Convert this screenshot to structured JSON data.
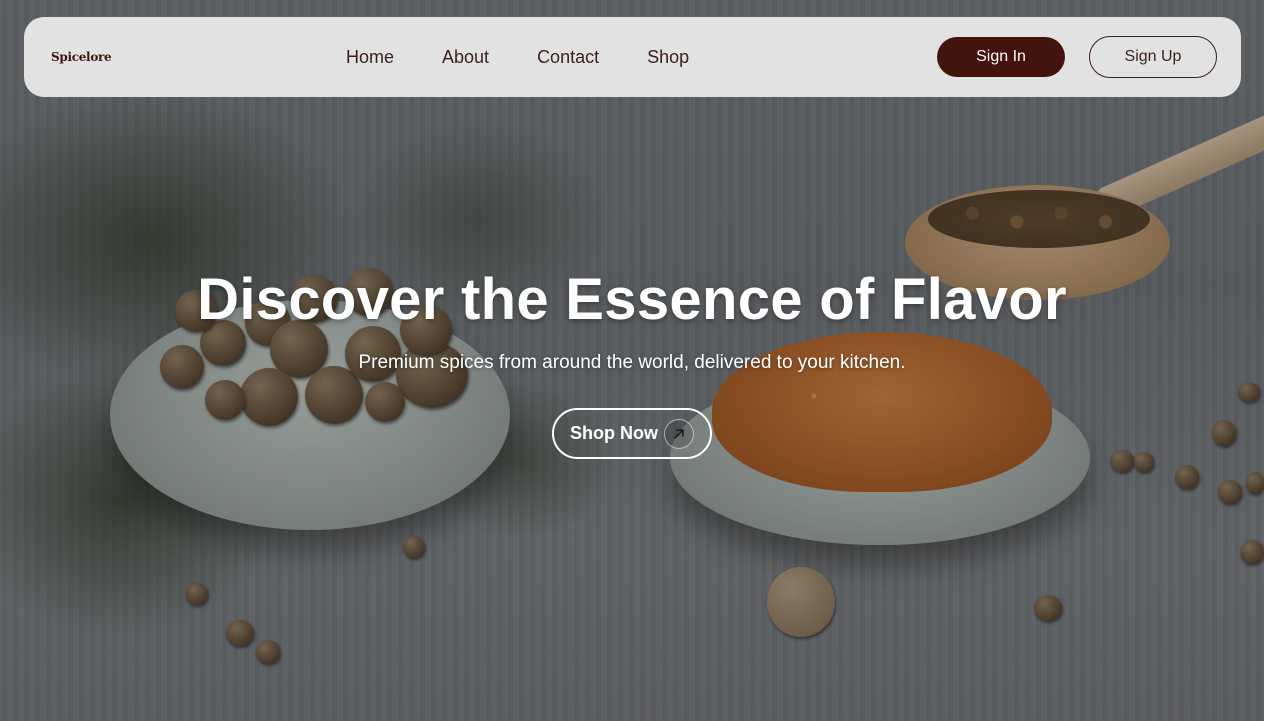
{
  "brand": {
    "logo_text": "Spicelore"
  },
  "nav": {
    "links": [
      {
        "label": "Home"
      },
      {
        "label": "About"
      },
      {
        "label": "Contact"
      },
      {
        "label": "Shop"
      }
    ],
    "sign_in_label": "Sign In",
    "sign_up_label": "Sign Up"
  },
  "hero": {
    "title": "Discover the Essence of Flavor",
    "subtitle": "Premium spices from around the world, delivered to your kitchen.",
    "cta_label": "Shop Now",
    "cta_icon": "arrow-up-right-icon",
    "background_image": "spices-on-wooden-table"
  },
  "colors": {
    "brand": "#43140d",
    "navbar_bg": "#e2e2e2",
    "hero_text": "#ffffff"
  }
}
